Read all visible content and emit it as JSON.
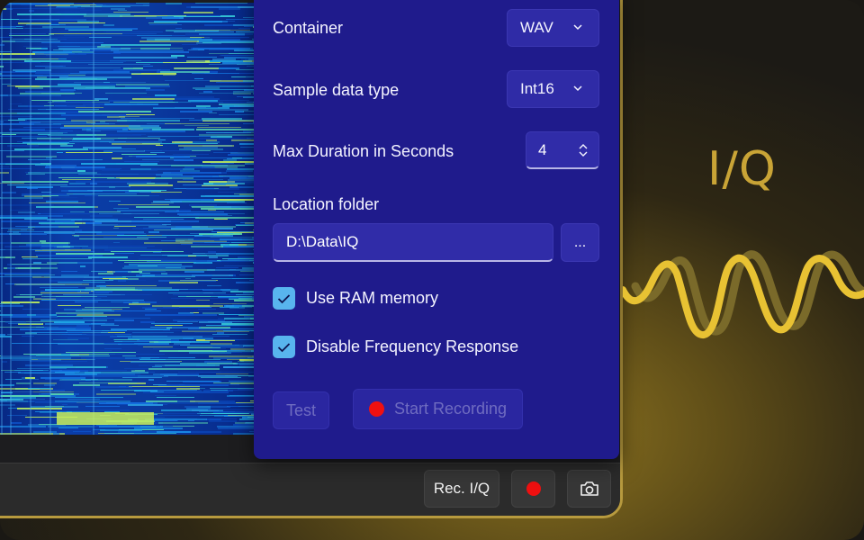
{
  "panel": {
    "container": {
      "label": "Container",
      "value": "WAV"
    },
    "sample_type": {
      "label": "Sample data type",
      "value": "Int16"
    },
    "max_duration": {
      "label": "Max Duration in Seconds",
      "value": "4"
    },
    "location": {
      "label": "Location folder",
      "value": "D:\\Data\\IQ",
      "browse_label": "..."
    },
    "use_ram": {
      "label": "Use RAM memory",
      "checked": true
    },
    "disable_freq": {
      "label": "Disable Frequency Response",
      "checked": true
    },
    "test_label": "Test",
    "start_label": "Start Recording"
  },
  "toolbar": {
    "rec_iq_label": "Rec. I/Q",
    "record_icon": "record-icon",
    "camera_icon": "camera-icon"
  },
  "brand": {
    "title": "I/Q",
    "accent": "#c9a436",
    "wave_color": "#e8c233"
  },
  "colors": {
    "panel_bg": "#1f1b8c",
    "checkbox": "#58b4ee",
    "record_red": "#ef1010"
  }
}
